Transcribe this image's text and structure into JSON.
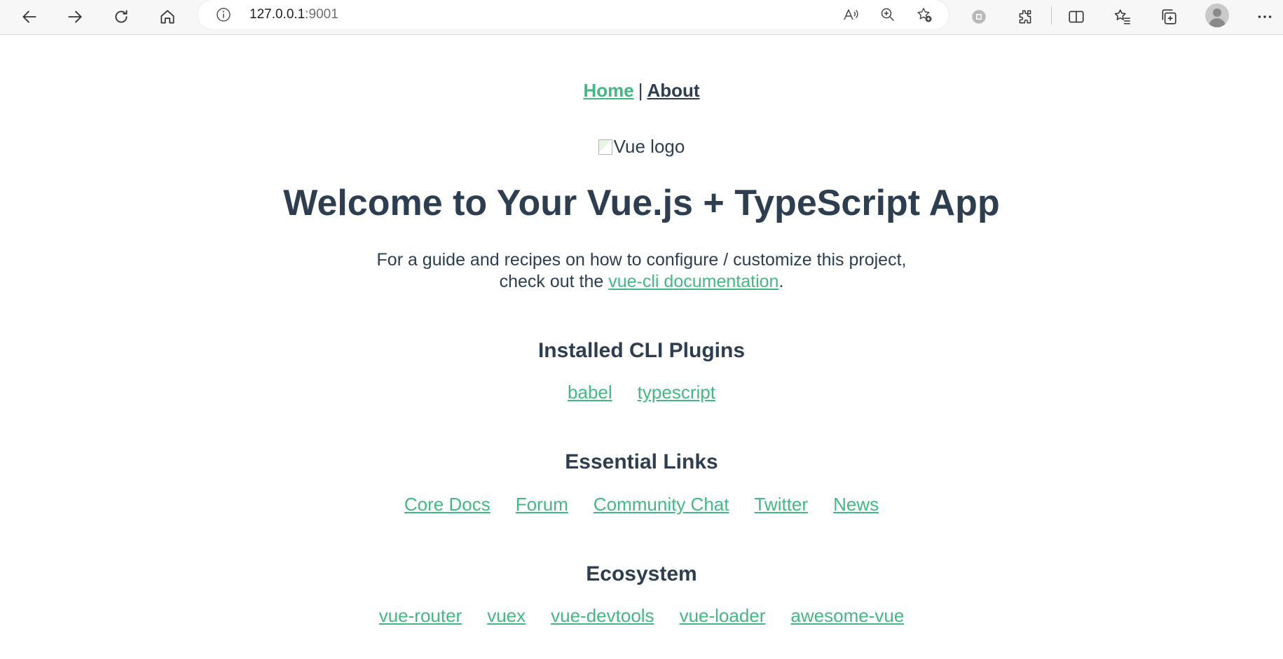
{
  "browser": {
    "url_host": "127.0.0.1",
    "url_port": ":9001",
    "icons": {
      "back": "arrow-left-icon",
      "forward": "arrow-right-icon",
      "refresh": "refresh-icon",
      "home": "home-icon",
      "info": "info-icon",
      "read_aloud": "read-aloud-icon",
      "zoom": "zoom-icon",
      "favorite_add": "star-plus-icon",
      "extension": "extension-puzzle-icon",
      "split": "split-screen-icon",
      "favorites": "favorites-icon",
      "collections": "collections-icon",
      "profile": "profile-icon",
      "menu": "more-icon"
    }
  },
  "nav": {
    "home": "Home",
    "separator": "|",
    "about": "About"
  },
  "logo_alt": "Vue logo",
  "title": "Welcome to Your Vue.js + TypeScript App",
  "intro": {
    "line1": "For a guide and recipes on how to configure / customize this project,",
    "line2_prefix": "check out the ",
    "link": "vue-cli documentation",
    "line2_suffix": "."
  },
  "sections": {
    "plugins": {
      "heading": "Installed CLI Plugins",
      "links": [
        "babel",
        "typescript"
      ]
    },
    "essential": {
      "heading": "Essential Links",
      "links": [
        "Core Docs",
        "Forum",
        "Community Chat",
        "Twitter",
        "News"
      ]
    },
    "ecosystem": {
      "heading": "Ecosystem",
      "links": [
        "vue-router",
        "vuex",
        "vue-devtools",
        "vue-loader",
        "awesome-vue"
      ]
    }
  },
  "colors": {
    "text": "#2c3e50",
    "link": "#42b983"
  }
}
